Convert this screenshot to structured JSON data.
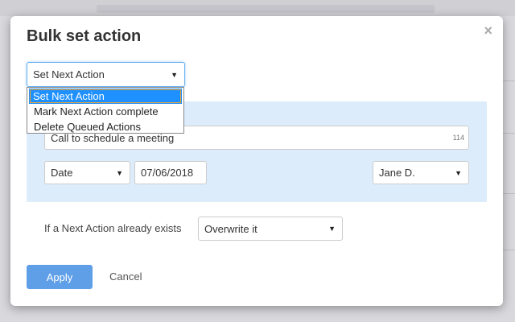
{
  "modal": {
    "title": "Bulk set action",
    "close_icon": "×"
  },
  "action_select": {
    "value": "Set Next Action",
    "options": [
      "Set Next Action",
      "Mark Next Action complete",
      "Delete Queued Actions"
    ],
    "selected_index": 0
  },
  "next_action": {
    "text": "Call to schedule a meeting",
    "char_count": "114",
    "date_type": "Date",
    "date": "07/06/2018",
    "assignee": "Jane D."
  },
  "existing": {
    "label": "If a Next Action already exists",
    "value": "Overwrite it"
  },
  "buttons": {
    "apply": "Apply",
    "cancel": "Cancel"
  },
  "colors": {
    "accent": "#5f9fe8",
    "panel": "#dcecfb",
    "selected_option": "#1e90ff"
  }
}
